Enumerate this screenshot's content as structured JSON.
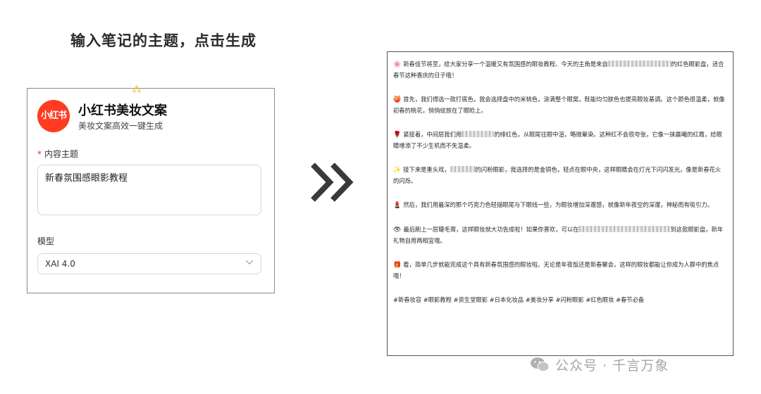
{
  "heading": "输入笔记的主题，点击生成",
  "form": {
    "logo_text": "小红书",
    "app_title": "小红书美妆文案",
    "app_subtitle": "美妆文案高效一键生成",
    "topic_required_mark": "*",
    "topic_label": "内容主题",
    "topic_value": "新春氛围感眼影教程",
    "model_label": "模型",
    "model_value": "XAI 4.0"
  },
  "output": {
    "paragraphs": [
      {
        "emoji": "🌸",
        "before": "新春佳节将至，给大家分享一个温暖又有氛围感的眼妆教程。今天的主角是来自",
        "after": "的红色眼影盘，适合春节这种喜庆的日子哦！"
      },
      {
        "emoji": "🍑",
        "before": "首先，我们得选一款打底色，我会选择盘中的米桃色，涂满整个眼窝，既能均匀肤色也提亮眼妆基调。这个颜色很温柔，就像初春的桃花，悄悄绽放在了眼睑上。",
        "after": ""
      },
      {
        "emoji": "🌹",
        "before": "紧接着，中间层我们用",
        "after": "的绯红色，从眼尾往眼中渲，略微晕染。这种红不会很夸张，它像一抹晨曦的红霞，给眼睛增添了不少生机而不失温柔。"
      },
      {
        "emoji": "✨",
        "before": "接下来是重头戏，",
        "after": "的闪粉眼影，我选择的是金铜色，轻点在眼中央，这样眼睛会在灯光下闪闪发光，像是新春花火的闪烁。"
      },
      {
        "emoji": "💄",
        "before": "然后，我们用最深的那个巧克力色轻描眼尾与下眼线一些，为眼妆增加深邃感，就像新年夜空的深邃，神秘而有吸引力。",
        "after": ""
      },
      {
        "emoji": "👁",
        "before": "最后刷上一层睫毛膏，这样眼妆就大功告成啦！如果你喜欢，可以在",
        "after": "到这款眼影盘，新年礼物自用两相宜哦。"
      },
      {
        "emoji": "🎁",
        "before": "看，简单几步就能完成这个具有新春氛围感的眼妆啦。无论是年夜饭还是新春聚会，这样的眼妆都能让你成为人群中的焦点哦！",
        "after": ""
      }
    ],
    "tags": "#新春妆容 #眼影教程 #资生堂眼影 #日本化妆品 #美妆分享 #闪粉眼影 #红色眼妆 #春节必备"
  },
  "watermark": "公众号 · 千言万象",
  "colors": {
    "brand": "#ff3b21",
    "required": "#e53935",
    "spark": "#f2c44d",
    "watermark": "#a6a6a6"
  }
}
